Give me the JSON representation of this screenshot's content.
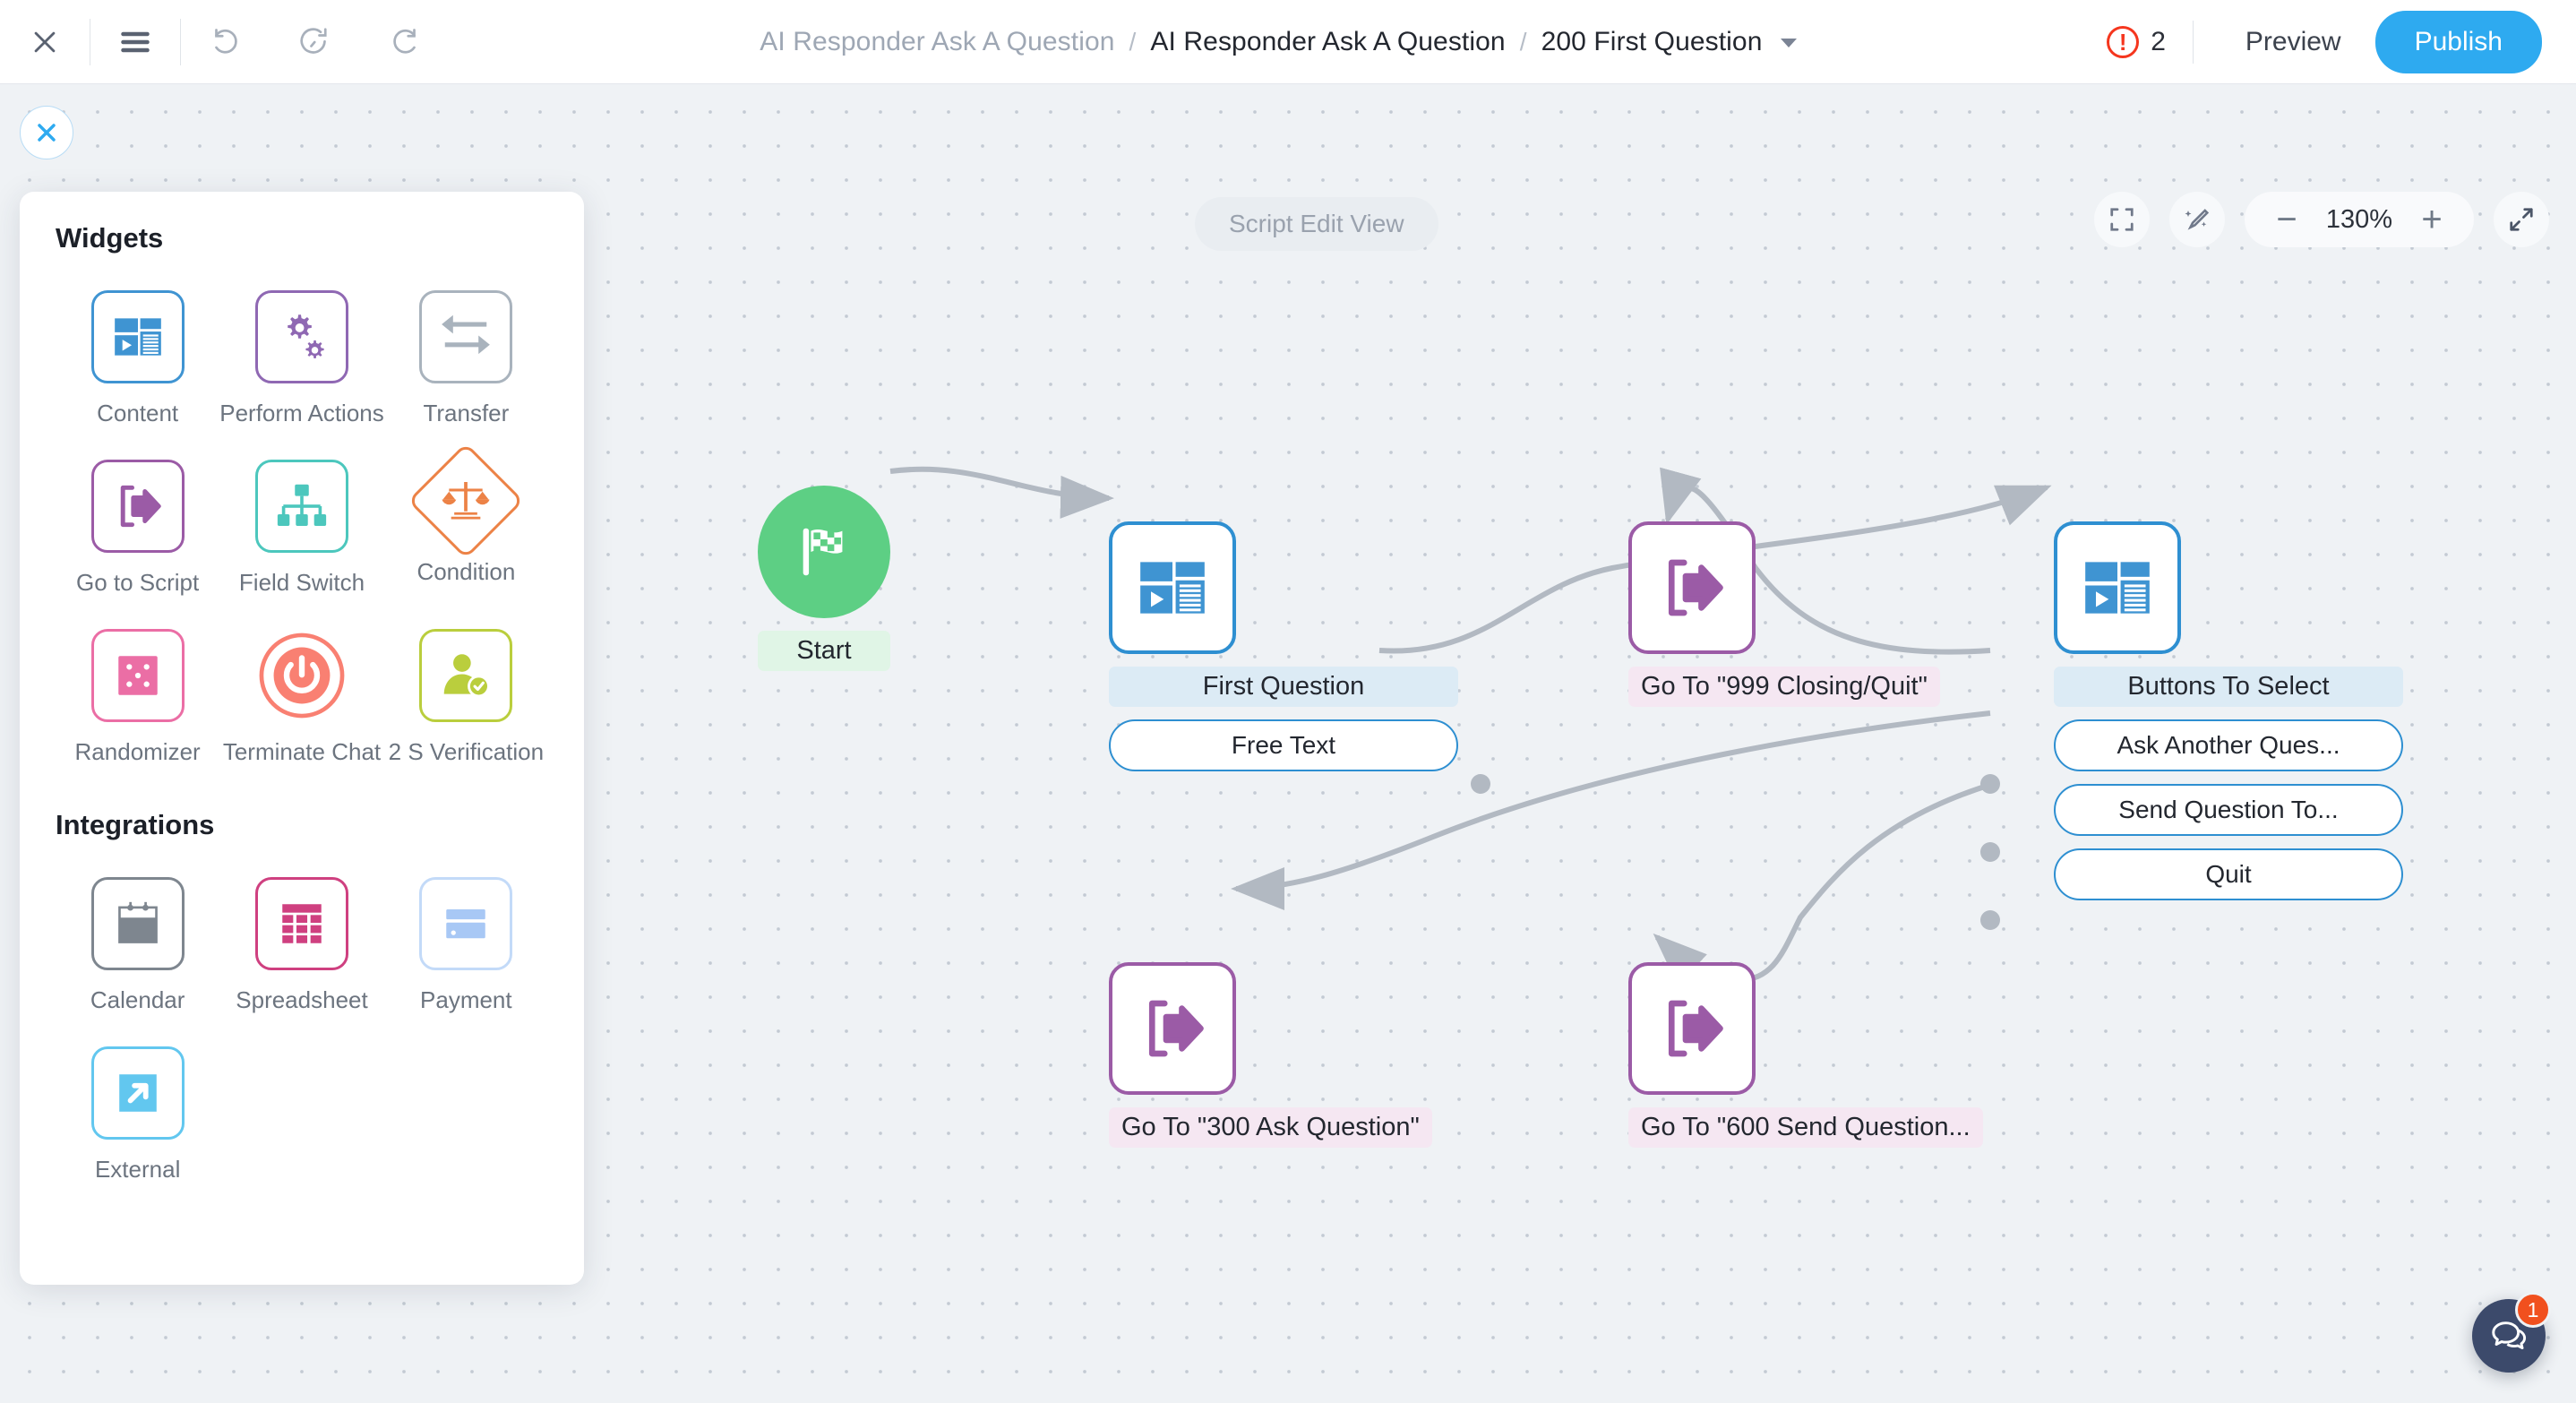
{
  "topbar": {
    "close_icon": "close-icon",
    "menu_icon": "hamburger-menu-icon",
    "undo_icon": "undo-icon",
    "history_icon": "restore-history-icon",
    "redo_icon": "redo-icon",
    "breadcrumb": {
      "root": "AI Responder Ask A Question",
      "sep1": "/",
      "parent": "AI Responder Ask A Question",
      "sep2": "/",
      "current": "200 First Question"
    },
    "error_count": "2",
    "preview_label": "Preview",
    "publish_label": "Publish"
  },
  "canvas": {
    "close_panel_icon": "close-icon",
    "view_badge": "Script Edit View",
    "zoom": {
      "fit_icon": "fit-to-screen-icon",
      "magic_icon": "auto-arrange-wand-icon",
      "minus": "−",
      "level": "130%",
      "plus": "+",
      "expand_icon": "expand-diagonal-icon"
    },
    "chat": {
      "icon": "chat-bubbles-icon",
      "badge": "1"
    }
  },
  "panel": {
    "widgets_title": "Widgets",
    "integrations_title": "Integrations",
    "widgets": [
      {
        "label": "Content",
        "icon": "content-layout-icon",
        "color": "#3f94d2"
      },
      {
        "label": "Perform Actions",
        "icon": "gears-icon",
        "color": "#8f68b3"
      },
      {
        "label": "Transfer",
        "icon": "transfer-arrows-icon",
        "color": "#a9b3bd"
      },
      {
        "label": "Go to Script",
        "icon": "exit-arrow-icon",
        "color": "#9b5ba6"
      },
      {
        "label": "Field Switch",
        "icon": "hierarchy-icon",
        "color": "#4cc7bd"
      },
      {
        "label": "Condition",
        "icon": "scales-balance-icon",
        "color": "#ec8246"
      },
      {
        "label": "Randomizer",
        "icon": "dice-icon",
        "color": "#eb6ea5"
      },
      {
        "label": "Terminate Chat",
        "icon": "power-off-icon",
        "color": "#f98072"
      },
      {
        "label": "2 S Verification",
        "icon": "person-verified-icon",
        "color": "#bace3d"
      }
    ],
    "integrations": [
      {
        "label": "Calendar",
        "icon": "calendar-icon",
        "color": "#7e868f"
      },
      {
        "label": "Spreadsheet",
        "icon": "spreadsheet-icon",
        "color": "#cf4080"
      },
      {
        "label": "Payment",
        "icon": "credit-card-icon",
        "color": "#a8c8f5"
      },
      {
        "label": "External",
        "icon": "external-link-icon",
        "color": "#62c7ef"
      }
    ]
  },
  "flow": {
    "start": {
      "label": "Start",
      "icon": "checkered-flag-icon"
    },
    "first_question": {
      "label": "First Question",
      "icon": "content-layout-icon",
      "option": "Free Text"
    },
    "goto_closing": {
      "label": "Go To \"999 Closing/Quit\"",
      "icon": "exit-arrow-icon"
    },
    "buttons_to_select": {
      "label": "Buttons To Select",
      "icon": "content-layout-icon",
      "options": [
        "Ask Another Ques...",
        "Send Question To...",
        "Quit"
      ]
    },
    "goto_ask": {
      "label": "Go To \"300 Ask Question\"",
      "icon": "exit-arrow-icon"
    },
    "goto_send": {
      "label": "Go To \"600 Send Question...",
      "icon": "exit-arrow-icon"
    }
  }
}
